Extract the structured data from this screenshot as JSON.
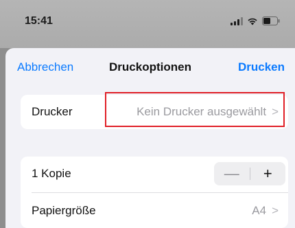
{
  "status": {
    "time": "15:41"
  },
  "nav": {
    "cancel": "Abbrechen",
    "title": "Druckoptionen",
    "print": "Drucken"
  },
  "printer": {
    "label": "Drucker",
    "value": "Kein Drucker ausgewählt",
    "chevron": ">"
  },
  "copies": {
    "label": "1 Kopie",
    "minus": "—",
    "plus": "+"
  },
  "paper": {
    "label": "Papiergröße",
    "value": "A4",
    "chevron": ">"
  },
  "icons": [
    "signal-icon",
    "wifi-icon",
    "battery-icon",
    "chevron-right-icon"
  ],
  "colors": {
    "accent": "#0a7aff",
    "highlight": "#e01e26"
  }
}
